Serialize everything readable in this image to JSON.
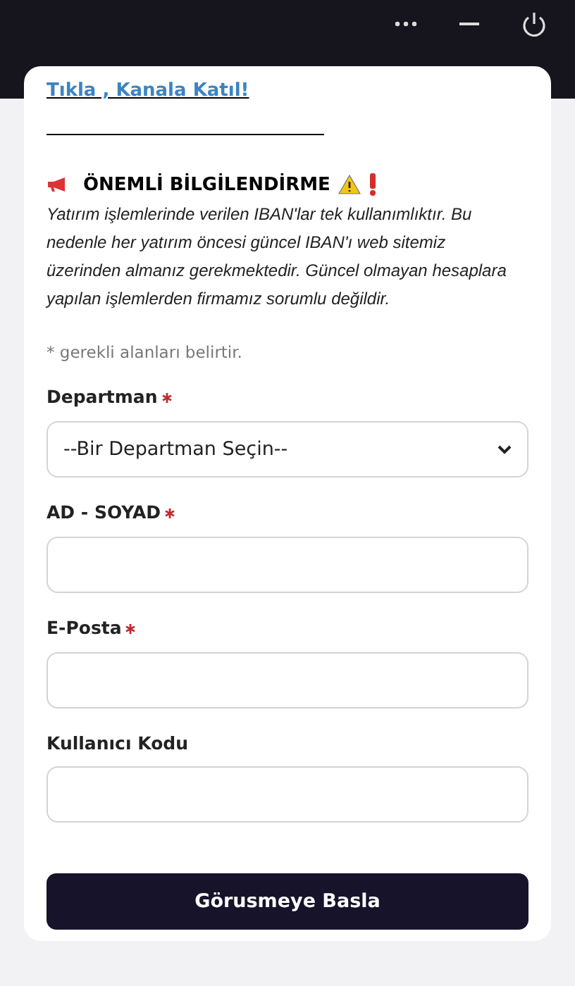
{
  "window_controls": [
    {
      "kind": "more"
    },
    {
      "kind": "minimize"
    },
    {
      "kind": "power"
    }
  ],
  "link": "Tıkla , Kanala Katıl!",
  "notice": {
    "title": "ÖNEMLİ BİLGİLENDİRME",
    "text": "Yatırım işlemlerinde verilen IBAN'lar tek kullanımlıktır. Bu nedenle her yatırım öncesi güncel IBAN'ı web sitemiz üzerinden almanız gerekmektedir. Güncel olmayan hesaplara yapılan işlemlerden firmamız sorumlu değildir."
  },
  "required_note": "* gerekli alanları belirtir.",
  "fields": [
    {
      "kind": "select",
      "label": "Departman",
      "required": true,
      "value": "--Bir Departman Seçin--"
    },
    {
      "kind": "text",
      "label": "AD - SOYAD",
      "required": true
    },
    {
      "kind": "text",
      "label": "E-Posta",
      "required": true
    },
    {
      "kind": "text",
      "label": "Kullanıcı Kodu",
      "required": false
    }
  ],
  "submit": "Görusmeye Basla"
}
